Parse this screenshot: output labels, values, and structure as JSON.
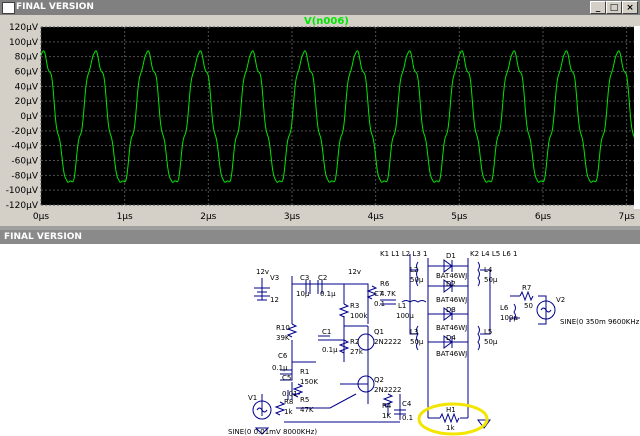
{
  "top_window": {
    "title": "FINAL VERSION",
    "trace_label": "V(n006)",
    "trace_color": "#00e600"
  },
  "chart_data": {
    "type": "line",
    "title": "V(n006)",
    "xlabel": "",
    "ylabel": "",
    "x_ticks": [
      "0µs",
      "1µs",
      "2µs",
      "3µs",
      "4µs",
      "5µs",
      "6µs",
      "7µs"
    ],
    "y_ticks": [
      "120µV",
      "100µV",
      "80µV",
      "60µV",
      "40µV",
      "20µV",
      "0µV",
      "-20µV",
      "-40µV",
      "-60µV",
      "-80µV",
      "-100µV",
      "-120µV"
    ],
    "xlim": [
      0,
      7.1
    ],
    "ylim": [
      -120,
      120
    ],
    "x_unit": "µs",
    "y_unit": "µV",
    "grid": true,
    "series": [
      {
        "name": "V(n006)",
        "description_values": {
          "carrier_frequency_khz": 1600,
          "carrier_amplitude_uv": 88,
          "ripple_amplitude_uv": 10,
          "offset_uv": -3,
          "envelope_min_uv": -100,
          "envelope_max_uv": 102
        }
      }
    ]
  },
  "bottom_window": {
    "title": "FINAL VERSION",
    "labels": {
      "v3_name": "V3",
      "v3_val": "12",
      "v3_unit": "12v",
      "net_12v": "12v",
      "c3": "C3",
      "c3_val": "10µ",
      "c2": "C2",
      "c2_val": "0.1µ",
      "r3": "R3",
      "r3_val": "100k",
      "r6": "R6",
      "r6_val": "4.7K",
      "c7": "C7",
      "c7_val": "0.1",
      "l1": "L1",
      "l1_val": "100µ",
      "r10": "R10",
      "r10_val": "39K",
      "q1": "Q1",
      "q1_type": "2N2222",
      "c1": "C1",
      "c1_val": "0.1µ",
      "r2": "R2",
      "r2_val": "27k",
      "c6": "C6",
      "c6_val": "0.1µ",
      "c5": "C5",
      "c5_val": "0.01",
      "r1": "R1",
      "r1_val": "150K",
      "q2": "Q2",
      "q2_type": "2N2222",
      "v1": "V1",
      "r8": "R8",
      "r8_val": "1k",
      "r5": "R5",
      "r5_val": "47K",
      "r4": "R4",
      "r4_val": "1K",
      "c4": "C4",
      "c4_val": "0.1",
      "v1_spec": "SINE(0 0.01mV 8000KHz)",
      "k1": "K1 L1 L2 L3 1",
      "k2": "K2 L4 L5 L6 1",
      "l2": "L2",
      "l2_val": "50µ",
      "l3": "L3",
      "l3_val": "50µ",
      "l4": "L4",
      "l4_val": "50µ",
      "l5": "L5",
      "l5_val": "50µ",
      "l6": "L6",
      "l6_val": "100µ",
      "d1": "D1",
      "d1_type": "BAT46WJ",
      "d2": "D2",
      "d2_type": "BAT46WJ",
      "d3": "D3",
      "d3_type": "BAT46WJ",
      "d4": "D4",
      "d4_type": "BAT46WJ",
      "r7": "R7",
      "r7_val": "50",
      "v2": "V2",
      "v2_spec": "SINE(0 350m 9600KHz)",
      "r_h1": "H1",
      "r_h1_val": "1k"
    },
    "highlight_color": "#f2e600"
  }
}
